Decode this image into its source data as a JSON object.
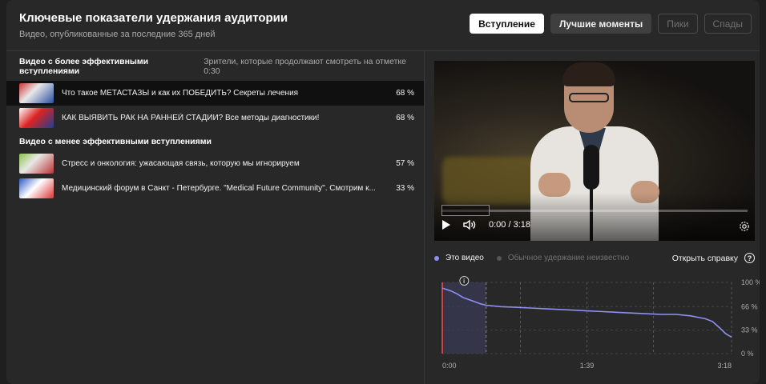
{
  "header": {
    "title": "Ключевые показатели удержания аудитории",
    "subtitle": "Видео, опубликованные за последние 365 дней"
  },
  "tabs": [
    {
      "label": "Вступление",
      "state": "active"
    },
    {
      "label": "Лучшие моменты",
      "state": "secondary"
    },
    {
      "label": "Пики",
      "state": "disabled"
    },
    {
      "label": "Спады",
      "state": "disabled"
    }
  ],
  "sections": {
    "better": {
      "title": "Видео с более эффективными вступлениями",
      "note": "Зрители, которые продолжают смотреть на отметке 0:30"
    },
    "worse": {
      "title": "Видео с менее эффективными вступлениями"
    }
  },
  "better_videos": [
    {
      "title": "Что такое МЕТАСТАЗЫ и как их ПОБЕДИТЬ? Секреты лечения",
      "percent": "68 %",
      "highlighted": true
    },
    {
      "title": "КАК ВЫЯВИТЬ РАК НА РАННЕЙ СТАДИИ? Все методы диагностики!",
      "percent": "68 %",
      "highlighted": false
    }
  ],
  "worse_videos": [
    {
      "title": "Стресс и онкология: ужасающая связь, которую мы игнорируем",
      "percent": "57 %"
    },
    {
      "title": "Медицинский форум в Санкт - Петербурге. \"Medical Future Community\". Смотрим к...",
      "percent": "33 %"
    }
  ],
  "player": {
    "time": "0:00 / 3:18",
    "icons": [
      "play-icon",
      "volume-icon",
      "settings-gear-icon"
    ]
  },
  "legend": {
    "this_video": "Это видео",
    "typical": "Обычное удержание неизвестно",
    "help": "Открыть справку",
    "help_glyph": "?"
  },
  "colors": {
    "accent": "#8f8ff5",
    "highlight_region": "#3a3a55",
    "marker": "#ff4e45"
  },
  "chart_data": {
    "type": "area",
    "ylim": [
      0,
      100
    ],
    "y_ticks": [
      "100 %",
      "66 %",
      "33 %",
      "0 %"
    ],
    "x_ticks": [
      "0:00",
      "1:39",
      "3:18"
    ],
    "x_duration_s": 198,
    "highlight_range_s": [
      0,
      30
    ],
    "info_marker_glyph": "i",
    "series": [
      {
        "x": [
          0,
          3,
          6,
          10,
          14,
          18,
          22,
          26,
          30,
          40,
          50,
          60,
          70,
          80,
          90,
          99,
          110,
          120,
          130,
          140,
          150,
          160,
          170,
          175,
          180,
          185,
          190,
          194,
          198
        ],
        "y": [
          92,
          90,
          88,
          84,
          79,
          76,
          73,
          70,
          68,
          66,
          65,
          64,
          63,
          62,
          61,
          60,
          59,
          58,
          57,
          56,
          55,
          55,
          53,
          51,
          49,
          45,
          36,
          28,
          23
        ]
      }
    ]
  }
}
